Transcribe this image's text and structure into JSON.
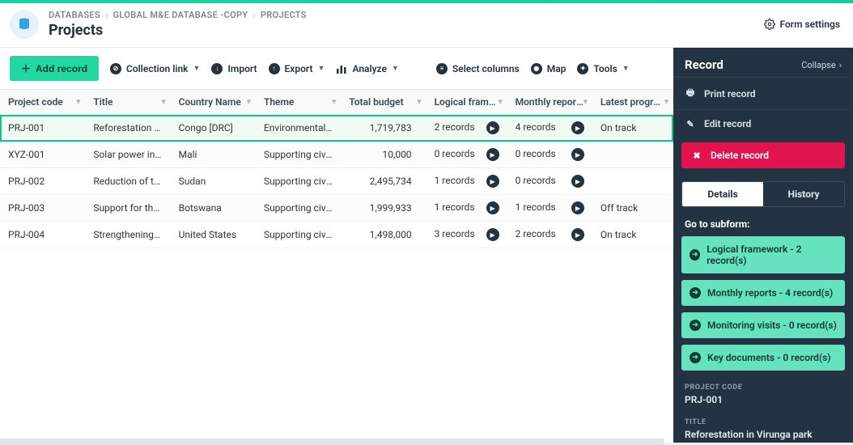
{
  "breadcrumb": {
    "a": "DATABASES",
    "b": "GLOBAL M&E DATABASE -COPY",
    "c": "PROJECTS"
  },
  "page_title": "Projects",
  "form_settings": "Form settings",
  "toolbar": {
    "add": "Add record",
    "collection": "Collection link",
    "import": "Import",
    "export": "Export",
    "analyze": "Analyze",
    "columns": "Select columns",
    "map": "Map",
    "tools": "Tools"
  },
  "columns": {
    "code": "Project code",
    "title": "Title",
    "country": "Country Name",
    "theme": "Theme",
    "budget": "Total budget",
    "logical": "Logical framew…",
    "monthly": "Monthly reports",
    "progress": "Latest progress"
  },
  "rows": [
    {
      "code": "PRJ-001",
      "title": "Reforestation in …",
      "country": "Congo [DRC]",
      "theme": "Environmental c…",
      "budget": "1,719,783",
      "logical": "2 records",
      "monthly": "4 records",
      "progress": "On track",
      "selected": true
    },
    {
      "code": "XYZ-001",
      "title": "Solar power in Mali",
      "country": "Mali",
      "theme": "Supporting civil s…",
      "budget": "10,000",
      "logical": "0 records",
      "monthly": "0 records",
      "progress": ""
    },
    {
      "code": "PRJ-002",
      "title": "Reduction of tens…",
      "country": "Sudan",
      "theme": "Supporting civil s…",
      "budget": "2,495,734",
      "logical": "1 records",
      "monthly": "0 records",
      "progress": ""
    },
    {
      "code": "PRJ-003",
      "title": "Support for the p…",
      "country": "Botswana",
      "theme": "Supporting civil s…",
      "budget": "1,999,933",
      "logical": "1 records",
      "monthly": "1 records",
      "progress": "Off track"
    },
    {
      "code": "PRJ-004",
      "title": "Strengthening ca…",
      "country": "United States",
      "theme": "Supporting civil s…",
      "budget": "1,498,000",
      "logical": "3 records",
      "monthly": "2 records",
      "progress": "On track"
    }
  ],
  "panel": {
    "heading": "Record",
    "collapse": "Collapse",
    "print": "Print record",
    "edit": "Edit record",
    "delete": "Delete record",
    "tab_details": "Details",
    "tab_history": "History",
    "subform_title": "Go to subform:",
    "sublinks": [
      "Logical framework - 2 record(s)",
      "Monthly reports - 4 record(s)",
      "Monitoring visits - 0 record(s)",
      "Key documents - 0 record(s)"
    ],
    "field1_label": "PROJECT CODE",
    "field1_value": "PRJ-001",
    "field2_label": "TITLE",
    "field2_value": "Reforestation in Virunga park"
  }
}
